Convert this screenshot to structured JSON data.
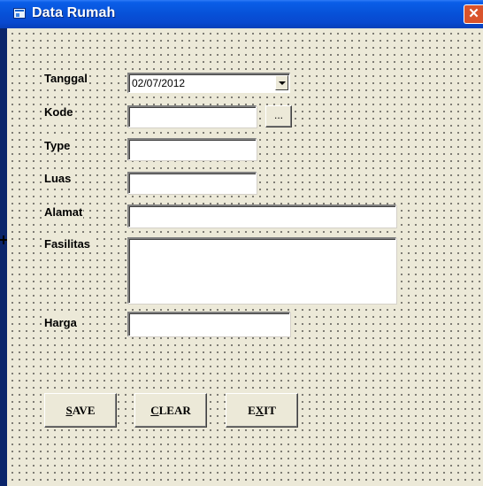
{
  "window": {
    "title": "Data Rumah",
    "close_glyph": "✕"
  },
  "form": {
    "fields": {
      "tanggal_label": "Tanggal",
      "tanggal_value": "02/07/2012",
      "kode_label": "Kode",
      "kode_value": "",
      "kode_browse_label": "...",
      "type_label": "Type",
      "type_value": "",
      "luas_label": "Luas",
      "luas_value": "",
      "alamat_label": "Alamat",
      "alamat_value": "",
      "fasilitas_label": "Fasilitas",
      "fasilitas_value": "",
      "harga_label": "Harga",
      "harga_value": ""
    },
    "buttons": {
      "save_first": "S",
      "save_rest": "AVE",
      "clear_first": "C",
      "clear_rest": "LEAR",
      "exit_pre": "E",
      "exit_u": "X",
      "exit_post": "IT"
    }
  },
  "icons": {
    "app_icon": "form-window-icon",
    "dropdown_icon": "chevron-down-icon",
    "close_icon": "close-icon"
  },
  "colors": {
    "titlebar": "#0752d9",
    "form_background": "#ece9d8",
    "close_button": "#d9532b"
  }
}
